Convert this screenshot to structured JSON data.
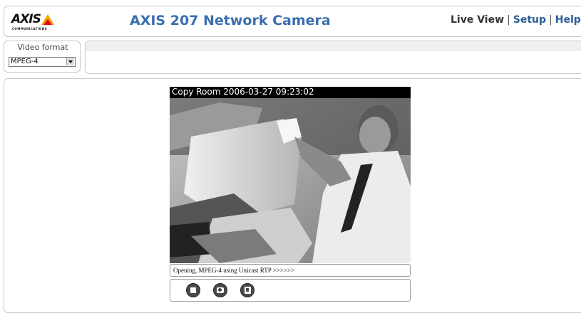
{
  "header": {
    "logo_text": "AXIS",
    "logo_subtext": "COMMUNICATIONS",
    "title": "AXIS 207 Network Camera",
    "nav": {
      "live_view": "Live View",
      "setup": "Setup",
      "help": "Help",
      "separator": "|"
    }
  },
  "video_format": {
    "label": "Video format",
    "selected": "MPEG-4"
  },
  "video": {
    "overlay_text": "Copy Room  2006-03-27 09:23:02"
  },
  "status": {
    "text": "Opening, MPEG-4 using Unicast RTP >>>>>>"
  },
  "controls": {
    "buttons": [
      "stop-icon",
      "snapshot-icon",
      "fullscreen-icon"
    ]
  },
  "colors": {
    "title": "#3a6eb0",
    "nav_link": "#2c5d98",
    "logo_triangle": "#f5a300",
    "button": "#4a4a4a"
  }
}
